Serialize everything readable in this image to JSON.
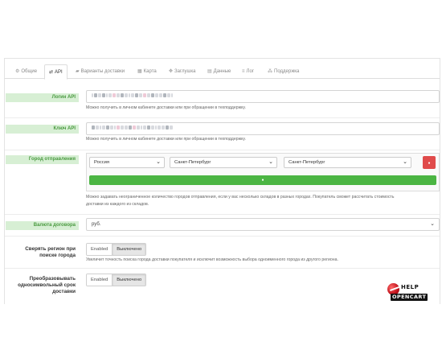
{
  "tabs": [
    {
      "label": "Общие",
      "icon": "gears-icon",
      "glyph": "⚙"
    },
    {
      "label": "API",
      "icon": "exchange-icon",
      "glyph": "⇄"
    },
    {
      "label": "Варианты доставки",
      "icon": "truck-icon",
      "glyph": "▰"
    },
    {
      "label": "Карта",
      "icon": "map-icon",
      "glyph": "▦"
    },
    {
      "label": "Заглушка",
      "icon": "arrows-icon",
      "glyph": "✥"
    },
    {
      "label": "Данные",
      "icon": "database-icon",
      "glyph": "▤"
    },
    {
      "label": "Лог",
      "icon": "list-icon",
      "glyph": "≡"
    },
    {
      "label": "Поддержка",
      "icon": "support-icon",
      "glyph": "⁂"
    }
  ],
  "active_tab": "API",
  "fields": {
    "login": {
      "label": "Логин API",
      "help": "Можно получить в личном кабинете доставки или при обращении в техподдержку."
    },
    "key": {
      "label": "Ключ API",
      "help": "Можно получить в личном кабинете доставки или при обращении в техподдержку."
    },
    "city": {
      "label": "Город отправления",
      "country": "Россия",
      "region": "Санкт-Петербург",
      "city": "Санкт-Петербург",
      "remove_glyph": "●",
      "add_glyph": "●",
      "help_line1": "Можно задавать неограниченное количество городов отправления, если у вас несколько складов в разных городах. Покупатель сможет рассчитать стоимость",
      "help_line2": "доставки из каждого из складов."
    },
    "currency": {
      "label": "Валюта договора",
      "value": "руб."
    },
    "region_check": {
      "label_line1": "Сверять регион при",
      "label_line2": "поиске города",
      "enabled": "Enabled",
      "disabled": "Выключено",
      "help": "Увеличит точность поиска города доставки покупателя и исключит возможность выбора одноименного города из другого региона."
    },
    "single_term": {
      "label_line1": "Преобразовывать",
      "label_line2": "односимвольный срок",
      "label_line3": "доставки",
      "enabled": "Enabled",
      "disabled": "Выключено"
    }
  },
  "watermark": {
    "line1": "HELP",
    "line2": "OPENCART"
  },
  "colors": {
    "label_green_bg": "#d7efd4",
    "label_green_text": "#4a9a40",
    "danger": "#e04b4b",
    "success": "#4bb543"
  }
}
